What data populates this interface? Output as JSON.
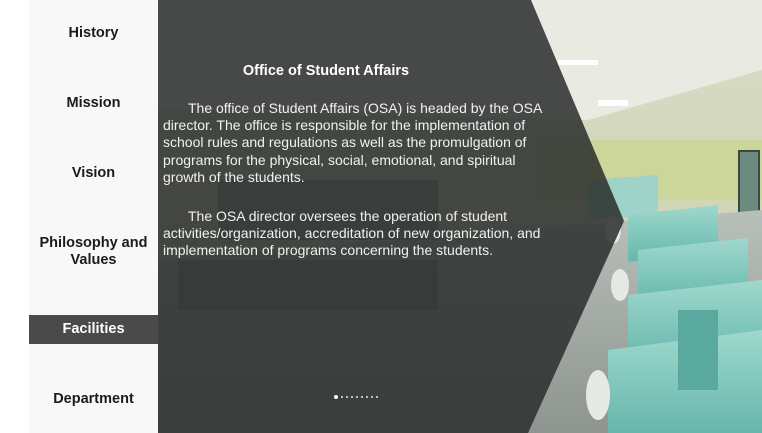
{
  "nav": {
    "items": [
      {
        "label": "History"
      },
      {
        "label": "Mission"
      },
      {
        "label": "Vision"
      },
      {
        "label": "Philosophy and Values"
      },
      {
        "label": "Facilities"
      },
      {
        "label": "Department"
      }
    ],
    "active": "Facilities"
  },
  "slide": {
    "title": "Office of Student Affairs",
    "paragraphs": [
      "The office of Student Affairs (OSA) is headed by the OSA director. The office is responsible for the implementation of school rules and regulations as well as the promulgation of programs for the physical, social, emotional, and spiritual growth of the students.",
      "The OSA director oversees the operation of student activities/organization, accreditation of new organization, and implementation of programs concerning the students."
    ],
    "image": "computer laboratory photo",
    "pagination": {
      "total": 9,
      "current": 1
    }
  },
  "colors": {
    "sidebar_bg": "#f8f8f8",
    "active_bg": "#4a4a4a",
    "overlay": "#2b2e2d"
  }
}
